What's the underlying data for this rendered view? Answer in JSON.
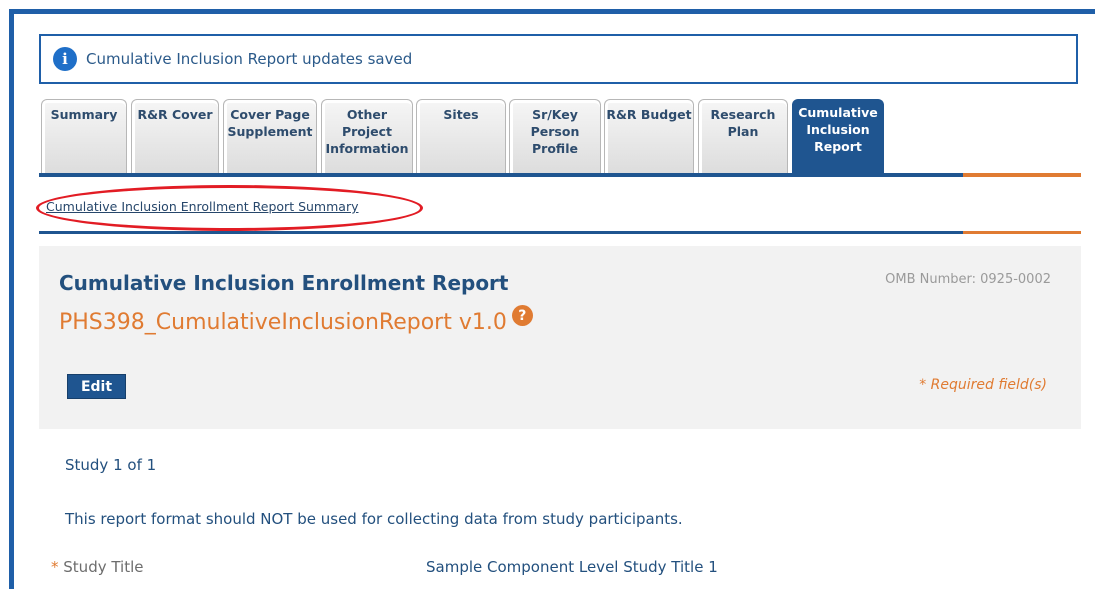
{
  "alert": {
    "icon": "info-icon",
    "message": "Cumulative Inclusion Report updates saved"
  },
  "tabs": [
    {
      "label": "Summary",
      "active": false
    },
    {
      "label": "R&R Cover",
      "active": false
    },
    {
      "label": "Cover Page Supplement",
      "active": false
    },
    {
      "label": "Other Project Information",
      "active": false
    },
    {
      "label": "Sites",
      "active": false
    },
    {
      "label": "Sr/Key Person Profile",
      "active": false
    },
    {
      "label": "R&R Budget",
      "active": false
    },
    {
      "label": "Research Plan",
      "active": false
    },
    {
      "label": "Cumulative Inclusion Report",
      "active": true
    }
  ],
  "subnav": {
    "link": "Cumulative Inclusion Enrollment Report Summary"
  },
  "form": {
    "title": "Cumulative Inclusion Enrollment Report",
    "subtitle": "PHS398_CumulativeInclusionReport v1.0",
    "help_icon": "?",
    "omb": "OMB Number: 0925-0002",
    "edit_label": "Edit",
    "required_note": "* Required field(s)"
  },
  "study": {
    "count": "Study 1 of 1",
    "notice": "This report format should NOT be used for collecting data from study participants.",
    "title_label_marker": "*",
    "title_label": "Study Title",
    "title_value": "Sample Component Level Study Title 1"
  },
  "colors": {
    "brand_blue": "#1f5590",
    "accent_orange": "#e07b32",
    "highlight_red": "#e21c24"
  }
}
